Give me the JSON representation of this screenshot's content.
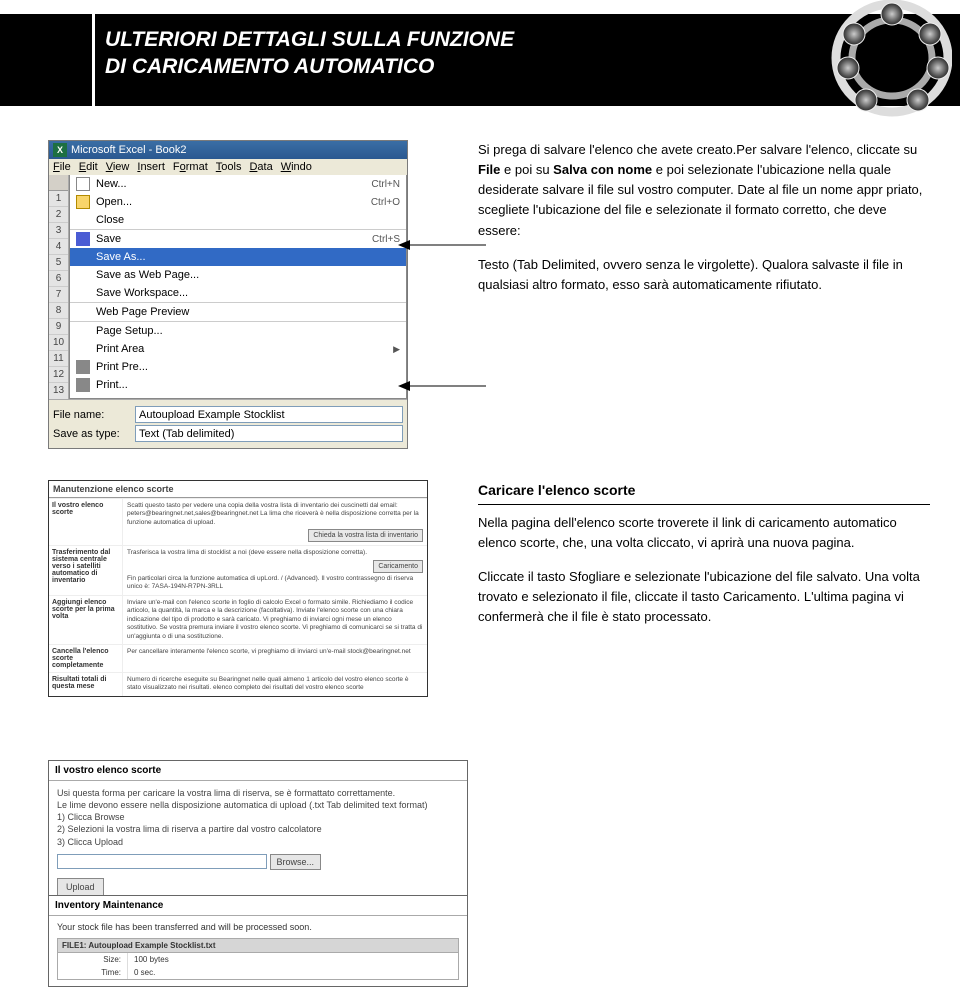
{
  "header": {
    "title_line1": "ULTERIORI DETTAGLI SULLA FUNZIONE",
    "title_line2": "DI CARICAMENTO AUTOMATICO"
  },
  "excel": {
    "title": "Microsoft Excel - Book2",
    "menus": [
      "File",
      "Edit",
      "View",
      "Insert",
      "Format",
      "Tools",
      "Data",
      "Windo"
    ],
    "file_menu": {
      "new": {
        "label": "New...",
        "shortcut": "Ctrl+N"
      },
      "open": {
        "label": "Open...",
        "shortcut": "Ctrl+O"
      },
      "close": {
        "label": "Close"
      },
      "save": {
        "label": "Save",
        "shortcut": "Ctrl+S"
      },
      "saveas": {
        "label": "Save As..."
      },
      "saveweb": {
        "label": "Save as Web Page..."
      },
      "savews": {
        "label": "Save Workspace..."
      },
      "webprev": {
        "label": "Web Page Preview"
      },
      "pagesetup": {
        "label": "Page Setup..."
      },
      "printarea": {
        "label": "Print Area"
      },
      "printprev": {
        "label": "Print Pre..."
      },
      "print": {
        "label": "Print..."
      }
    },
    "rownums": [
      "1",
      "2",
      "3",
      "4",
      "5",
      "6",
      "7",
      "8",
      "9",
      "10",
      "11",
      "12",
      "13"
    ],
    "dialog": {
      "filename_label": "File name:",
      "filename_value": "Autoupload Example Stocklist",
      "savetype_label": "Save as type:",
      "savetype_value": "Text (Tab delimited)"
    }
  },
  "para1": {
    "p1a": "Si prega di salvare l'elenco che avete creato.Per salvare",
    "p1b": "l'elenco, cliccate su ",
    "p1b_b1": "File",
    "p1c": " e poi su ",
    "p1c_b2": "Salva con nome",
    "p1d": " e poi selezionate l'ubicazione nella quale desiderate salvare il file sul vostro computer. Date al file un nome appr priato, scegliete l'ubicazione del file e selezionate il formato corretto, che deve essere:",
    "p2": "Testo (Tab Delimited, ovvero senza le virgolette). Qualora salvaste il file in qualsiasi altro formato, esso sarà automaticamente rifiutato."
  },
  "webshot": {
    "title": "Manutenzione elenco scorte",
    "rows": {
      "r1_label": "Il vostro elenco scorte",
      "r1_desc": "Scatti questo tasto per vedere una copia della vostra lista di inventario dei cuscinetti dal email: peters@bearingnet.net,sales@bearingnet.net La lima che riceverà è nella disposizione corretta per la funzione automatica di upload.",
      "r1_btn": "Chieda la vostra lista di inventario",
      "r2_label": "Trasferimento dal sistema centrale verso i satelliti automatico di inventario",
      "r2_desc": "Trasferisca la vostra lima di stocklist a noi (deve essere nella disposizione corretta).",
      "r2_btn": "Caricamento",
      "r2_desc2": "Fin particolari circa la funzione automatica di upLord. / (Advanced). Il vostro contrassegno di riserva unico è: 7ASA-194N-R7PN-3RLL",
      "r3_label": "Aggiungi elenco scorte per la prima volta",
      "r3_desc": "Inviare un'e-mail con l'elenco scorte in foglio di calcolo Excel o formato simile. Richiediamo il codice articolo, la quantità, la marca e la descrizione (facoltativa). Inviate l'elenco scorte con una chiara indicazione del tipo di prodotto e sarà caricato. Vi preghiamo di inviarci ogni mese un elenco sostitutivo. Se vostra premura inviare il vostro elenco scorte. Vi preghiamo di comunicarci se si tratta di un'aggiunta o di una sostituzione.",
      "r4_label": "Cancella l'elenco scorte completamente",
      "r4_desc": "Per cancellare interamente l'elenco scorte, vi preghiamo di inviarci un'e-mail stock@bearingnet.net",
      "r5_label": "Risultati totali di questa mese",
      "r5_desc": "Numero di ricerche eseguite su Bearingnet nelle quali almeno 1 articolo del vostro elenco scorte è stato visualizzato nei risultati. elenco completo dei risultati del vostro elenco scorte"
    }
  },
  "para2": {
    "heading": "Caricare l'elenco scorte",
    "p1": "Nella pagina dell'elenco scorte troverete il link di caricamento automatico elenco scorte, che, una volta cliccato, vi aprirà una nuova pagina.",
    "p2": "Cliccate il tasto Sfogliare e selezionate l'ubicazione del file salvato. Una volta trovato e selezionato il file, cliccate il tasto Caricamento. L'ultima pagina vi confermerà che il file è stato processato."
  },
  "section3": {
    "title": "Il vostro elenco scorte",
    "desc1": "Usi questa forma per caricare la vostra lima di riserva, se è formattato correttamente.",
    "desc2": "Le lime devono essere nella disposizione automatica di upload (.txt Tab delimited text format)",
    "step1": "1) Clicca Browse",
    "step2": "2) Selezioni la vostra lima di riserva a partire dal vostro calcolatore",
    "step3": "3) Clicca Upload",
    "browse_btn": "Browse...",
    "upload_btn": "Upload"
  },
  "section4": {
    "title": "Inventory Maintenance",
    "msg": "Your stock file has been transferred and will be processed soon.",
    "file_title": "FILE1: Autoupload Example Stocklist.txt",
    "size_label": "Size:",
    "size_value": "100 bytes",
    "time_label": "Time:",
    "time_value": "0 sec."
  }
}
